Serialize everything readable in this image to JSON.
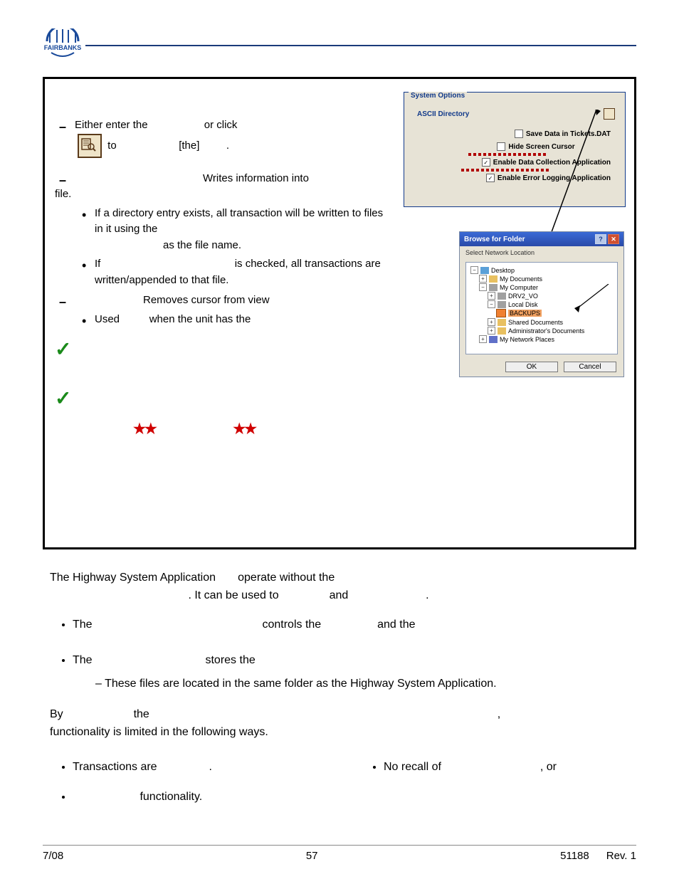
{
  "left": {
    "l1_a": "Either enter the",
    "l1_b": "or click",
    "l1_c": "to",
    "l1_d": "[the]",
    "l1_e": ".",
    "l2_a": "Writes information into",
    "l2_b": "file.",
    "sub1": "If a directory entry exists, all transaction will be written to files in it using the",
    "sub1b": "as the file name.",
    "sub2a": "If",
    "sub2b": "is checked, all transactions are written/appended to that file.",
    "l3": "Removes cursor from view",
    "sub3a": "Used",
    "sub3b": "when the unit has the"
  },
  "sysopt": {
    "title": "System Options",
    "ascii": "ASCII Directory",
    "save": "Save Data in Tickets.DAT",
    "hide": "Hide Screen Cursor",
    "dca": "Enable Data Collection Application",
    "ela": "Enable Error Logging Application"
  },
  "browse": {
    "title": "Browse for Folder",
    "subtitle": "Select Network Location",
    "items": {
      "desktop": "Desktop",
      "mydocs": "My Documents",
      "mycomp": "My Computer",
      "drv": "DRV2_VO",
      "local": "Local Disk",
      "backups": "BACKUPS",
      "shared": "Shared Documents",
      "admin": "Administrator's Documents",
      "netpl": "My Network Places"
    },
    "ok": "OK",
    "cancel": "Cancel"
  },
  "body": {
    "p1a": "The Highway System Application",
    "p1b": "operate without the",
    "p1c": ".  It can be used to",
    "p1d": "and",
    "p1e": ".",
    "li1a": "The",
    "li1b": "controls the",
    "li1c": "and the",
    "li2a": "The",
    "li2b": "stores the",
    "li2sub": "These files are located  in the same folder as the Highway System Application.",
    "p2a": "By",
    "p2b": "the",
    "p2c": ",",
    "p2d": "functionality is limited in the following ways.",
    "li3a": "Transactions are",
    "li3b": ".",
    "li4": "functionality.",
    "li5a": "No recall of",
    "li5b": ", or"
  },
  "footer": {
    "left": "7/08",
    "center": "57",
    "code": "51188",
    "rev": "Rev. 1"
  }
}
